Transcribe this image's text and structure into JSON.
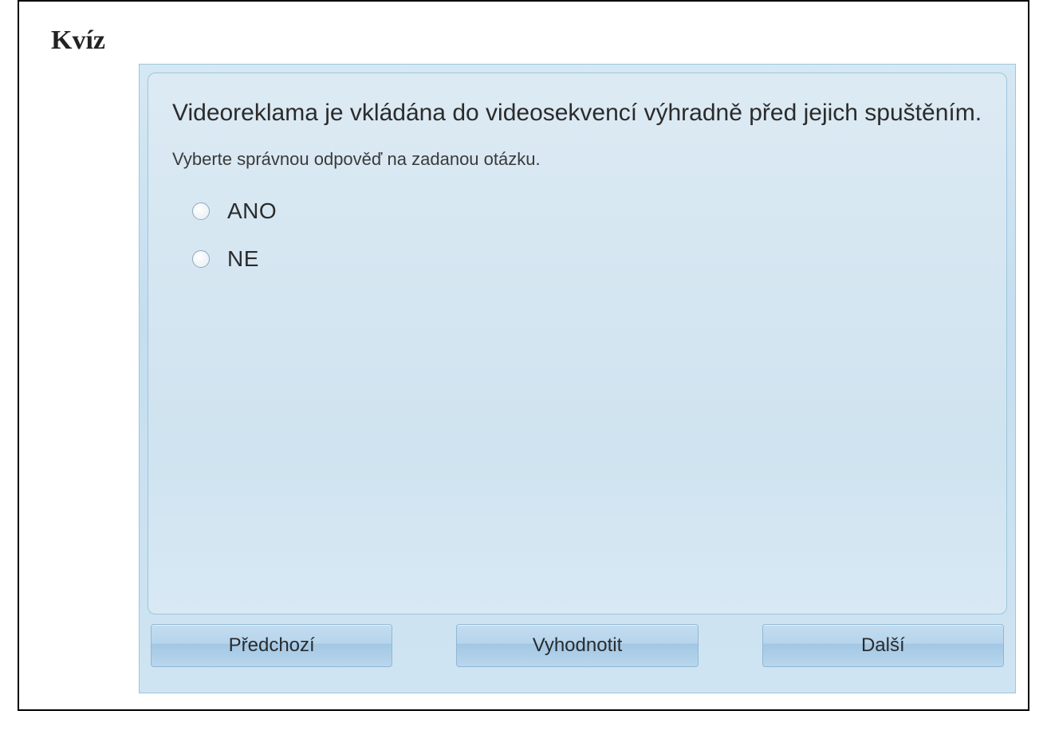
{
  "header": {
    "title": "Kvíz"
  },
  "quiz": {
    "question": "Videoreklama je vkládána do videosekvencí výhradně před jejich spuštěním.",
    "instruction": "Vyberte správnou odpověď na zadanou otázku.",
    "options": [
      {
        "label": "ANO"
      },
      {
        "label": "NE"
      }
    ]
  },
  "buttons": {
    "previous": "Předchozí",
    "evaluate": "Vyhodnotit",
    "next": "Další"
  }
}
